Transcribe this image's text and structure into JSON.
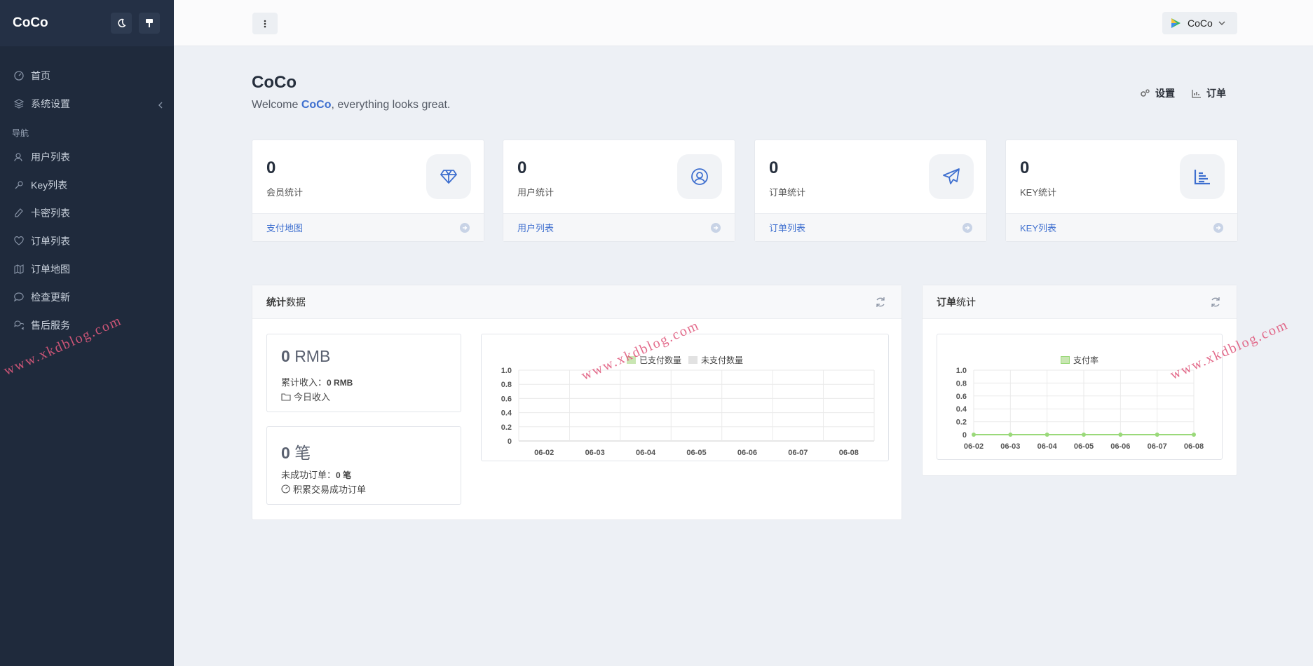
{
  "sidebar": {
    "brand": "CoCo",
    "items_top": [
      {
        "label": "首页",
        "icon": "dashboard-icon"
      },
      {
        "label": "系统设置",
        "icon": "layers-icon"
      }
    ],
    "section_heading": "导航",
    "items": [
      {
        "label": "用户列表",
        "icon": "user-icon"
      },
      {
        "label": "Key列表",
        "icon": "key-icon"
      },
      {
        "label": "卡密列表",
        "icon": "pen-icon"
      },
      {
        "label": "订单列表",
        "icon": "heart-icon"
      },
      {
        "label": "订单地图",
        "icon": "map-icon"
      },
      {
        "label": "检查更新",
        "icon": "chat-icon"
      },
      {
        "label": "售后服务",
        "icon": "chats-icon"
      }
    ]
  },
  "topbar": {
    "user_name": "CoCo"
  },
  "page": {
    "title": "CoCo",
    "welcome_prefix": "Welcome ",
    "welcome_name": "CoCo",
    "welcome_suffix": ", everything looks great.",
    "actions": [
      {
        "label": "设置",
        "icon": "gears-icon"
      },
      {
        "label": "订单",
        "icon": "chart-icon"
      }
    ]
  },
  "cards": [
    {
      "value": "0",
      "label": "会员统计",
      "link": "支付地图",
      "icon": "gem-icon"
    },
    {
      "value": "0",
      "label": "用户统计",
      "link": "用户列表",
      "icon": "user-circle-icon"
    },
    {
      "value": "0",
      "label": "订单统计",
      "link": "订单列表",
      "icon": "paper-plane-icon"
    },
    {
      "value": "0",
      "label": "KEY统计",
      "link": "KEY列表",
      "icon": "bar-chart-icon"
    }
  ],
  "stats_panel": {
    "title_bold": "统计",
    "title_rest": "数据",
    "revenue": {
      "value": "0",
      "unit": "RMB",
      "total_label": "累计收入：",
      "total_value": "0 RMB",
      "sub_label": "今日收入"
    },
    "orders": {
      "value": "0",
      "unit": "笔",
      "fail_label": "未成功订单：",
      "fail_value": "0 笔",
      "sub_label": "积累交易成功订单"
    }
  },
  "orders_panel": {
    "title_bold": "订单",
    "title_rest": "统计"
  },
  "watermark": "www.xkdblog.com",
  "colors": {
    "sidebar_bg": "#1f2a3c",
    "accent": "#3e6fcf",
    "paid_series": "#c9e6b3",
    "unpaid_series": "#e2e2e2",
    "rate_series": "#9ad97a"
  },
  "chart_data": [
    {
      "type": "bar",
      "categories": [
        "06-02",
        "06-03",
        "06-04",
        "06-05",
        "06-06",
        "06-07",
        "06-08"
      ],
      "series": [
        {
          "name": "已支付数量",
          "values": [
            0,
            0,
            0,
            0,
            0,
            0,
            0
          ]
        },
        {
          "name": "未支付数量",
          "values": [
            0,
            0,
            0,
            0,
            0,
            0,
            0
          ]
        }
      ],
      "ylim": [
        0,
        1.0
      ],
      "yticks": [
        "1.0",
        "0.8",
        "0.6",
        "0.4",
        "0.2",
        "0"
      ],
      "grid": true,
      "legend": "top"
    },
    {
      "type": "line",
      "categories": [
        "06-02",
        "06-03",
        "06-04",
        "06-05",
        "06-06",
        "06-07",
        "06-08"
      ],
      "series": [
        {
          "name": "支付率",
          "values": [
            0,
            0,
            0,
            0,
            0,
            0,
            0
          ]
        }
      ],
      "ylim": [
        0,
        1.0
      ],
      "yticks": [
        "1.0",
        "0.8",
        "0.6",
        "0.4",
        "0.2",
        "0"
      ],
      "grid": true,
      "legend": "top"
    }
  ]
}
